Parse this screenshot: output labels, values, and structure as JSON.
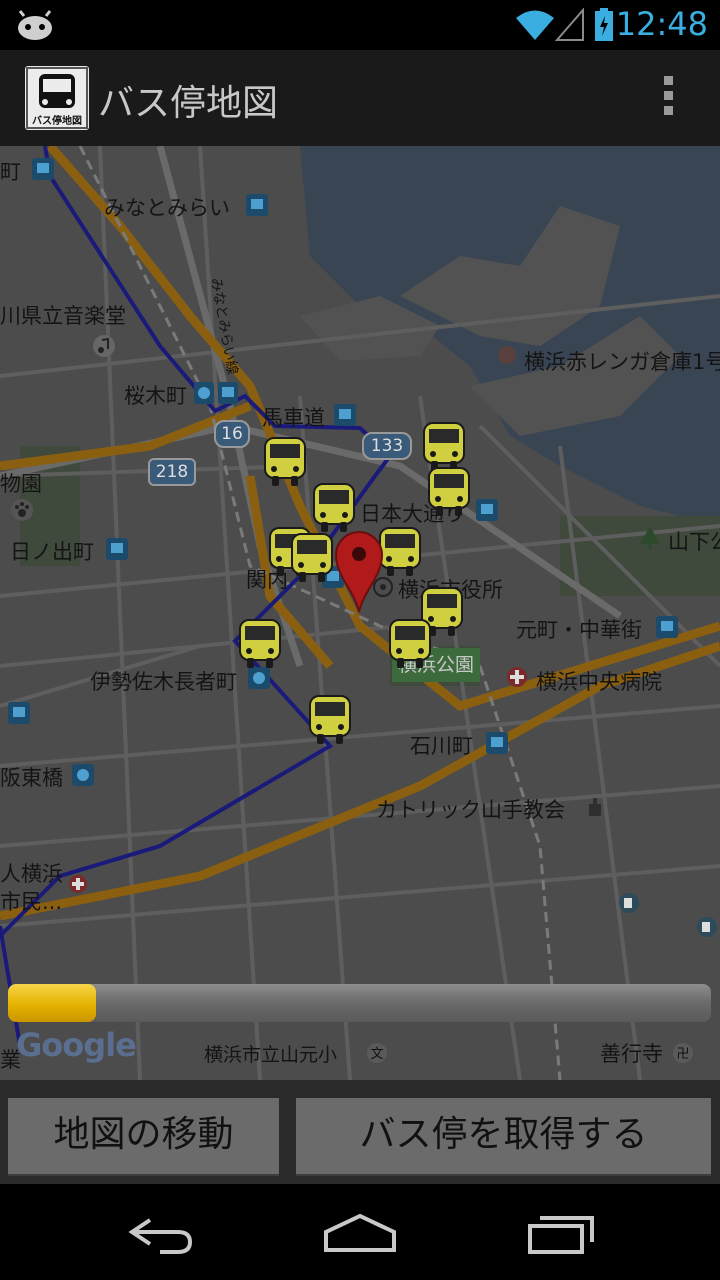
{
  "status_bar": {
    "time": "12:48",
    "icons": [
      "android-icon",
      "wifi-icon",
      "signal-icon",
      "battery-icon"
    ]
  },
  "action_bar": {
    "title": "バス停地図",
    "icon_label": "バス停地図",
    "overflow_icon": "overflow-menu-icon"
  },
  "map": {
    "labels": {
      "minatomirai": "みなとみらい",
      "minatomirai_line": "みなとみらい線",
      "kenritsu": "川県立音楽堂",
      "akarenga": "横浜赤レンガ倉庫1号",
      "sakuragicho": "桜木町",
      "bashamichi": "馬車道",
      "route133": "133",
      "route16": "16",
      "route218": "218",
      "zoo": "物園",
      "nihonodori": "日本大通り",
      "yamashita": "山下公",
      "hinodecho": "日ノ出町",
      "kannai": "関内",
      "shiyakusho": "横浜市役所",
      "motomachi": "元町・中華街",
      "yokohama_park": "横浜公園",
      "chuo_hospital": "横浜中央病院",
      "isezakichojamachi": "伊勢佐木長者町",
      "ishikawacho": "石川町",
      "bando": "阪東橋",
      "catholic": "カトリック山手教会",
      "hito_yokohama": "人横浜",
      "shimin": "市民...",
      "yamamoto_elem": "横浜市立山元小",
      "zengyoji": "善行寺",
      "top_left": "町",
      "bottom_left": "業"
    },
    "google_logo": "Google",
    "colors": {
      "route_line": "#1a1a7a",
      "highway": "#8a6010",
      "bus_marker": "#cfcf40",
      "pin": "#b01a1a"
    },
    "progress": 0.125
  },
  "buttons": {
    "move_map": "地図の移動",
    "get_bus_stops": "バス停を取得する"
  },
  "nav_bar": {
    "back": "back-icon",
    "home": "home-icon",
    "recents": "recents-icon"
  }
}
